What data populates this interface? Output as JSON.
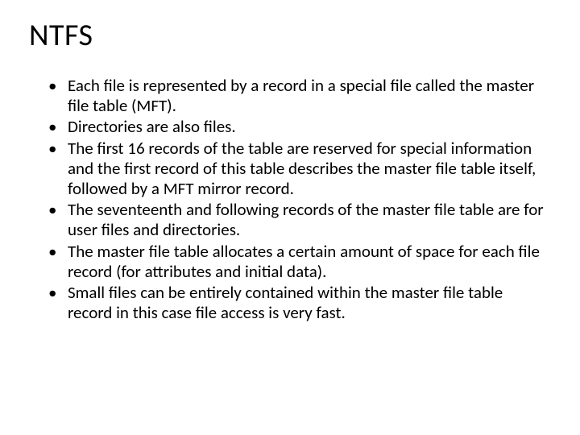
{
  "slide": {
    "title": "NTFS",
    "bullets": [
      "Each file is represented by a record in a special file called the master file table (MFT).",
      "Directories are also files.",
      "The first 16 records of the table are reserved for special information and the first record of this table describes the master file table itself, followed by a MFT mirror record.",
      "The seventeenth and following records of the master file table are for user files and directories.",
      "The master file table allocates a certain amount of space for each file record (for attributes and initial data).",
      "Small files can be entirely contained within the master file table record in this case file access is very fast."
    ]
  }
}
